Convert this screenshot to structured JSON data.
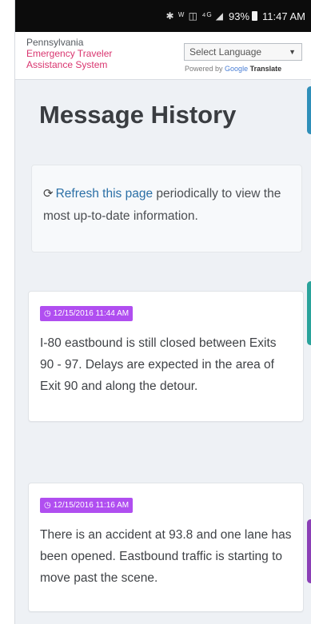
{
  "statusbar": {
    "icons": "✱ ᵂ ◫ ⁴ᴳ ◢",
    "battery": "93%",
    "time": "11:47 AM"
  },
  "header": {
    "org_line1": "Pennsylvania",
    "org_line2": "Emergency Traveler",
    "org_line3": "Assistance System",
    "language_select": "Select Language",
    "powered_by": "Powered by",
    "google": "Google",
    "translate": "Translate"
  },
  "page": {
    "title": "Message History"
  },
  "info": {
    "link_text": "Refresh this page",
    "text": " periodically to view the most up-to-date information."
  },
  "messages": [
    {
      "timestamp": "12/15/2016 11:44 AM",
      "text": "I-80 eastbound is still closed between Exits 90 - 97. Delays are expected in the area of Exit 90 and along the detour."
    },
    {
      "timestamp": "12/15/2016 11:16 AM",
      "text": "There is an accident at 93.8 and one lane has been opened. Eastbound traffic is starting to move past the scene."
    }
  ],
  "colors": {
    "accent_pink": "#d9356f",
    "badge_purple": "#b04ef0",
    "link_blue": "#2a6fa6"
  },
  "icons": {
    "refresh": "refresh-icon",
    "clock": "clock-icon",
    "dropdown": "chevron-down-icon"
  }
}
